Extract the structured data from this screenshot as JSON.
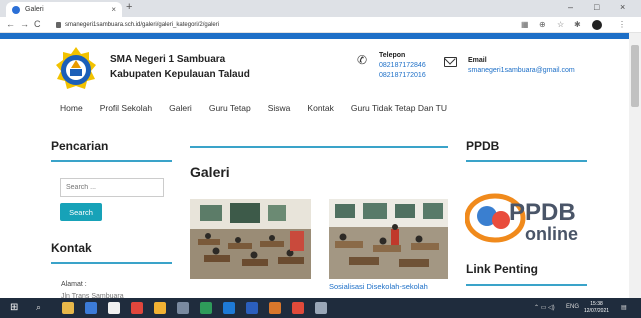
{
  "browser": {
    "tab_title": "Galeri",
    "tab_close": "×",
    "new_tab": "+",
    "url": "smanegeri1sambuara.sch.id/galeri/galeri_kategori/2/galeri",
    "window_controls": [
      "–",
      "□",
      "×"
    ]
  },
  "site": {
    "name_line1": "SMA Negeri 1 Sambuara",
    "name_line2": "Kabupaten Kepulauan Talaud",
    "phone_title": "Telepon",
    "phone_1": "082187172846",
    "phone_2": "082187172016",
    "email_title": "Email",
    "email": "smanegeri1sambuara@gmail.com",
    "accent": "#1d6fc7"
  },
  "nav": [
    "Home",
    "Profil Sekolah",
    "Galeri",
    "Guru Tetap",
    "Siswa",
    "Kontak",
    "Guru Tidak Tetap Dan TU"
  ],
  "sidebar_left": {
    "search_title": "Pencarian",
    "search_placeholder": "Search ...",
    "search_button": "Search",
    "contact_title": "Kontak",
    "address_label": "Alamat :",
    "address_value": "Jln Trans Sambuara"
  },
  "main": {
    "title": "Galeri",
    "captions": [
      "",
      "Sosialisasi Disekolah-sekolah"
    ]
  },
  "sidebar_right": {
    "ppdb_title": "PPDB",
    "ppdb_logo_text": "PPDB",
    "ppdb_logo_sub": "online",
    "links_title": "Link Penting"
  },
  "taskbar": {
    "time": "15:38",
    "date": "12/07/2021",
    "lang": "ENG"
  }
}
